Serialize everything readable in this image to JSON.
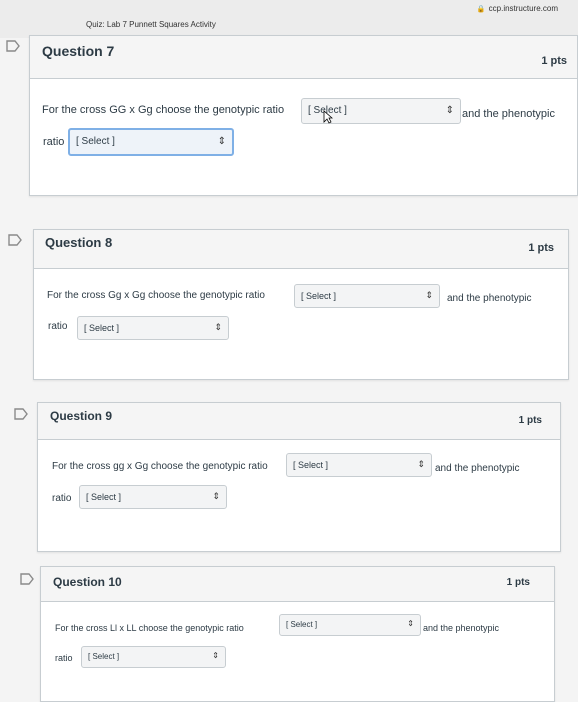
{
  "browser": {
    "domain": "ccp.instructure.com",
    "quiz_title": "Quiz: Lab 7 Punnett Squares Activity"
  },
  "questions": [
    {
      "name": "Question 7",
      "points": "1 pts",
      "prefix": "For the cross GG x Gg choose the genotypic ratio",
      "select1": "[ Select ]",
      "middle": "and the phenotypic",
      "ratio_label": "ratio",
      "select2": "[ Select ]"
    },
    {
      "name": "Question 8",
      "points": "1 pts",
      "prefix": "For the cross Gg x Gg choose the genotypic ratio",
      "select1": "[ Select ]",
      "middle": "and the phenotypic",
      "ratio_label": "ratio",
      "select2": "[ Select ]"
    },
    {
      "name": "Question 9",
      "points": "1 pts",
      "prefix": "For the cross gg x Gg choose the genotypic ratio",
      "select1": "[ Select ]",
      "middle": "and the phenotypic",
      "ratio_label": "ratio",
      "select2": "[ Select ]"
    },
    {
      "name": "Question 10",
      "points": "1 pts",
      "prefix": "For the cross Ll x LL choose the genotypic ratio",
      "select1": "[ Select ]",
      "middle": "and the phenotypic",
      "ratio_label": "ratio",
      "select2": "[ Select ]"
    }
  ],
  "icons": {
    "flag": "flag-icon",
    "select_arrow": "updown-arrow-icon",
    "lock": "lock-icon",
    "cursor": "mouse-cursor-icon"
  },
  "colors": {
    "header_bg": "#f5f5f5",
    "border": "#c7cdd1",
    "text": "#2d3b45",
    "focus": "#7fb0e6"
  }
}
